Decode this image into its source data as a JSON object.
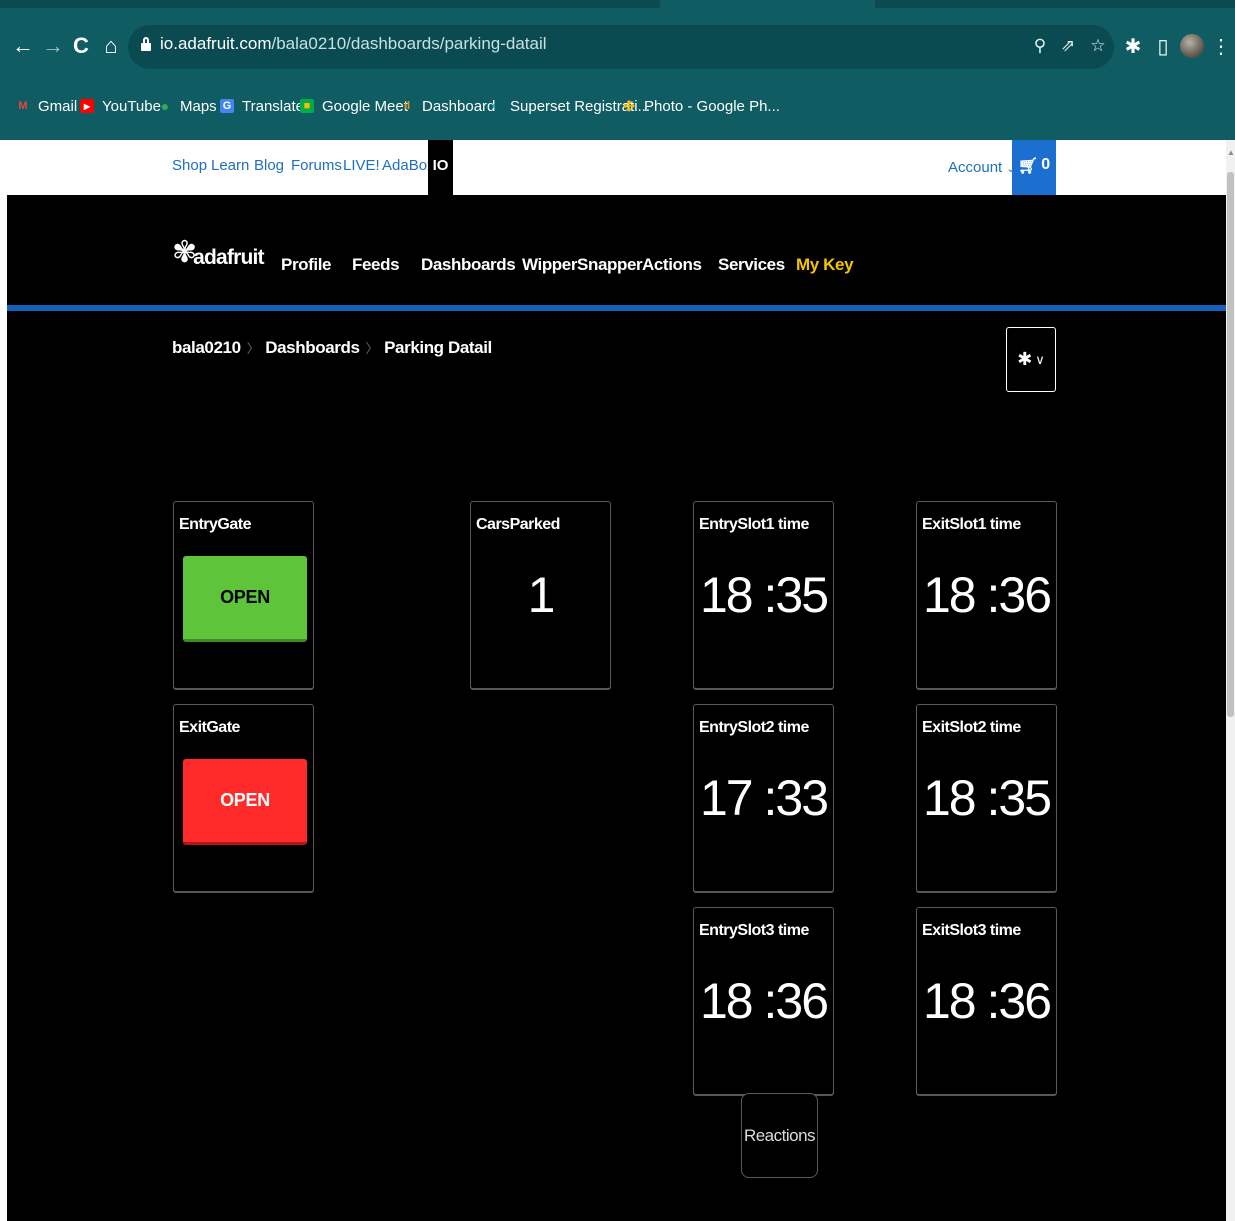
{
  "browser": {
    "url_host": "io.adafruit.com",
    "url_path": "/bala0210/dashboards/parking-datail",
    "bookmarks": [
      {
        "label": "Gmail",
        "icon": "gmail-icon",
        "color": "#ea4335",
        "glyph": "M"
      },
      {
        "label": "YouTube",
        "icon": "youtube-icon",
        "color": "#ff0000",
        "glyph": "▶"
      },
      {
        "label": "Maps",
        "icon": "maps-icon",
        "color": "#34a853",
        "glyph": "●"
      },
      {
        "label": "Translate",
        "icon": "translate-icon",
        "color": "#4285f4",
        "glyph": "G"
      },
      {
        "label": "Google Meet",
        "icon": "meet-icon",
        "color": "#00ac47",
        "glyph": "■"
      },
      {
        "label": "Dashboard",
        "icon": "dashboard-icon",
        "color": "#f29900",
        "glyph": "ıl"
      },
      {
        "label": "Superset Registrati...",
        "icon": "superset-icon",
        "color": "#20a7c9",
        "glyph": "◐"
      },
      {
        "label": "Photo - Google Ph...",
        "icon": "photos-icon",
        "color": "#fbbc04",
        "glyph": "✣"
      }
    ]
  },
  "site": {
    "top_links": [
      "Shop",
      "Learn",
      "Blog",
      "Forums",
      "LIVE!",
      "AdaBox"
    ],
    "io_tab": "IO",
    "account_label": "Account",
    "cart_count": "0",
    "logo_text": "adafruit",
    "nav": [
      "Profile",
      "Feeds",
      "Dashboards",
      "WipperSnapper",
      "Actions",
      "Services",
      "My Key"
    ]
  },
  "breadcrumb": [
    "bala0210",
    "Dashboards",
    "Parking Datail"
  ],
  "blocks": {
    "entry_gate": {
      "title": "EntryGate",
      "button": "OPEN",
      "color": "#5ec43a"
    },
    "exit_gate": {
      "title": "ExitGate",
      "button": "OPEN",
      "color": "#ff2a2a"
    },
    "cars_parked": {
      "title": "CarsParked",
      "value": "1"
    },
    "entry_slot1": {
      "title": "EntrySlot1 time",
      "value": "18 :35"
    },
    "exit_slot1": {
      "title": "ExitSlot1 time",
      "value": "18 :36"
    },
    "entry_slot2": {
      "title": "EntrySlot2 time",
      "value": "17 :33"
    },
    "exit_slot2": {
      "title": "ExitSlot2 time",
      "value": "18 :35"
    },
    "entry_slot3": {
      "title": "EntrySlot3 time",
      "value": "18 :36"
    },
    "exit_slot3": {
      "title": "ExitSlot3 time",
      "value": "18 :36"
    }
  },
  "reactions_label": "Reactions",
  "colors": {
    "chrome": "#0f5c63",
    "accent_blue": "#1461bb",
    "my_key": "#f5c400"
  }
}
